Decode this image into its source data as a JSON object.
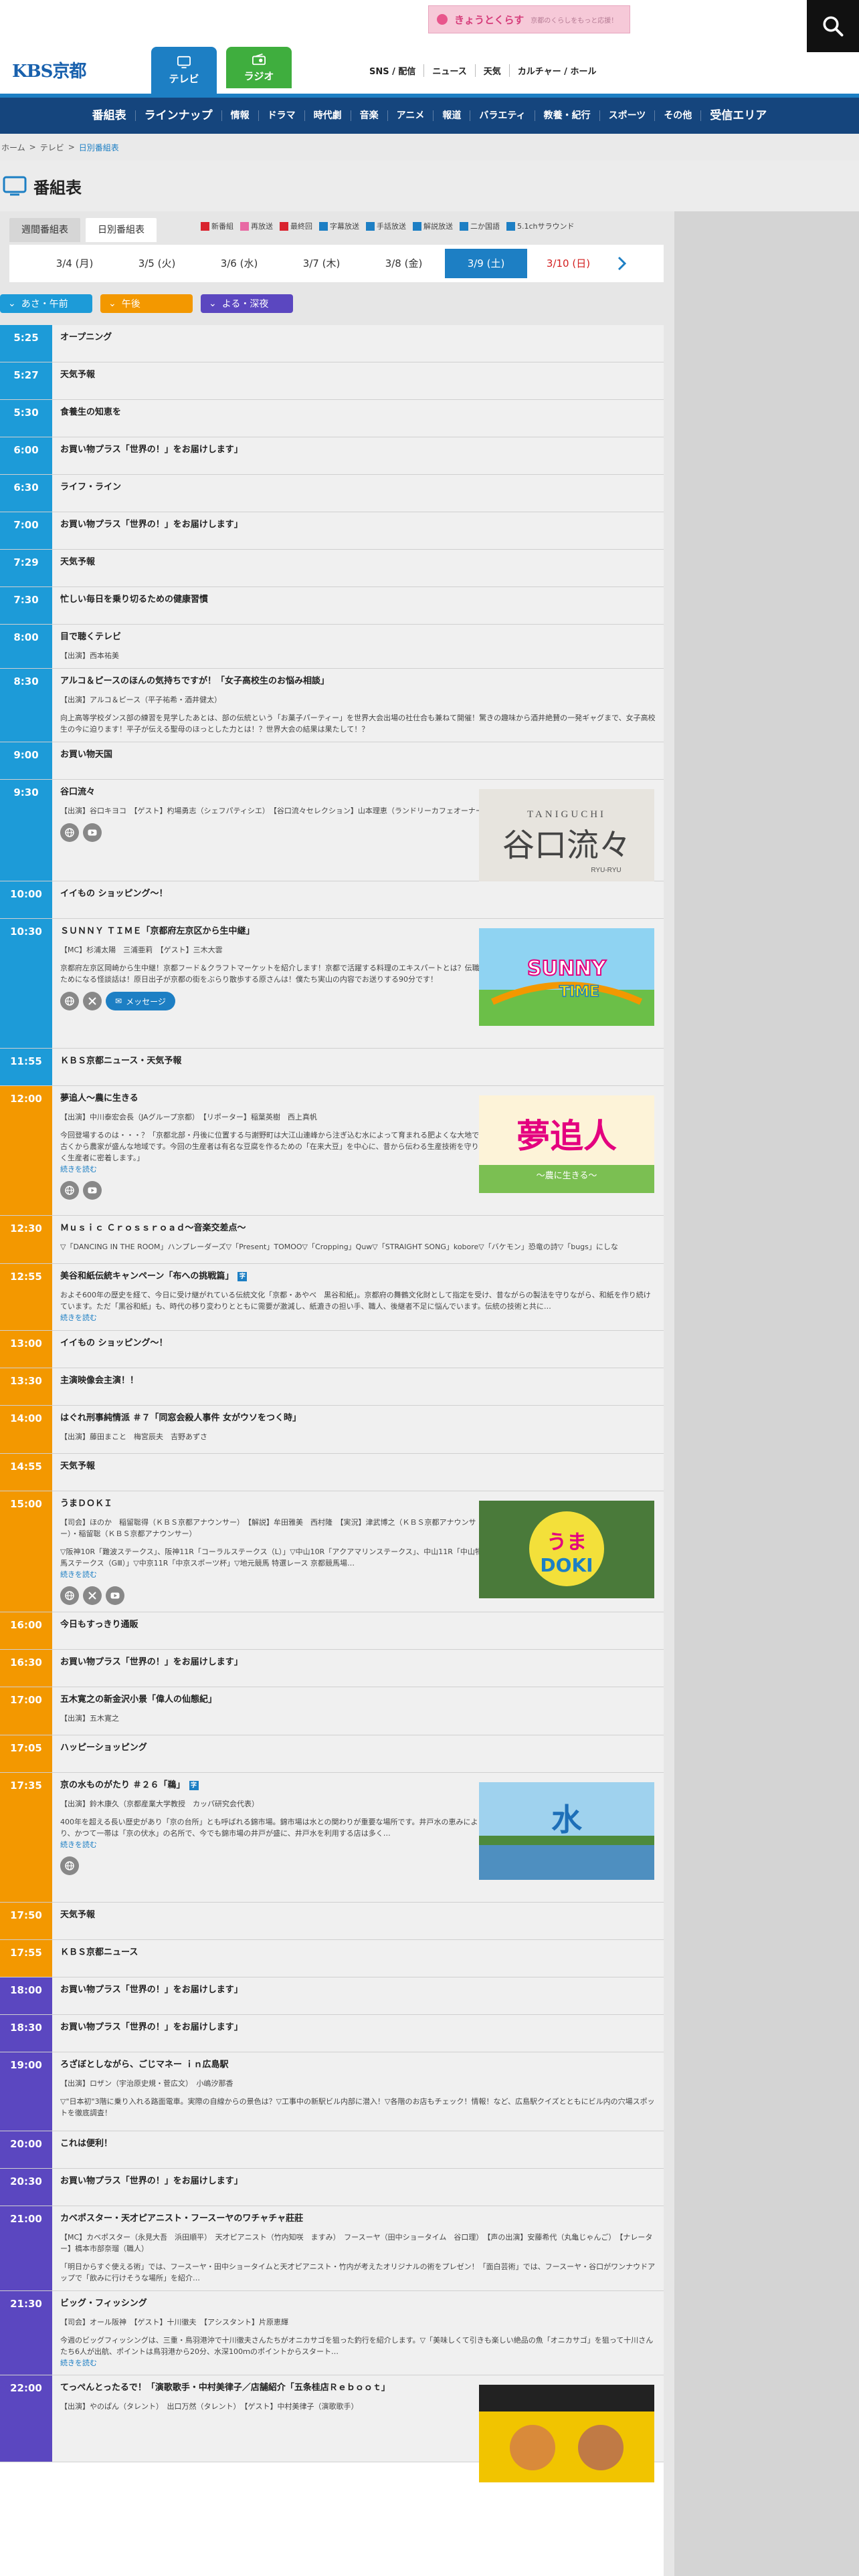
{
  "header": {
    "logo_text": "KBS京都",
    "promo_title": "きょうとくらす",
    "promo_sub": "京都のくらしをもっと応援！",
    "tab_tv": "テレビ",
    "tab_radio": "ラジオ",
    "links": [
      "SNS / 配信",
      "ニュース",
      "天気",
      "カルチャー / ホール"
    ]
  },
  "genre_nav": [
    "番組表",
    "ラインナップ",
    "情報",
    "ドラマ",
    "時代劇",
    "音楽",
    "アニメ",
    "報道",
    "バラエティ",
    "教養・紀行",
    "スポーツ",
    "その他",
    "受信エリア"
  ],
  "breadcrumb": [
    "ホーム",
    "テレビ",
    "日別番組表"
  ],
  "page_title": "番組表",
  "view_tabs": [
    "週間番組表",
    "日別番組表"
  ],
  "legend": [
    {
      "label": "新番組",
      "color": "#d9232e"
    },
    {
      "label": "再放送",
      "color": "#e86aa4"
    },
    {
      "label": "最終回",
      "color": "#d9232e"
    },
    {
      "label": "字幕放送",
      "color": "#1d7fc4"
    },
    {
      "label": "手話放送",
      "color": "#1d7fc4"
    },
    {
      "label": "解説放送",
      "color": "#1d7fc4"
    },
    {
      "label": "二か国語",
      "color": "#1d7fc4"
    },
    {
      "label": "5.1chサラウンド",
      "color": "#1d7fc4"
    }
  ],
  "dates": [
    "3/4 (月)",
    "3/5 (火)",
    "3/6 (水)",
    "3/7 (木)",
    "3/8 (金)",
    "3/9 (土)",
    "3/10 (日)"
  ],
  "time_tabs": [
    "あさ・午前",
    "午後",
    "よる・深夜"
  ],
  "programs": [
    {
      "time": "5:25",
      "title": "オープニング",
      "band": "m"
    },
    {
      "time": "5:27",
      "title": "天気予報",
      "band": "m"
    },
    {
      "time": "5:30",
      "title": "食養生の知恵を",
      "band": "m"
    },
    {
      "time": "6:00",
      "title": "お買い物プラス「世界の！」をお届けします」",
      "band": "m"
    },
    {
      "time": "6:30",
      "title": "ライフ・ライン",
      "band": "m"
    },
    {
      "time": "7:00",
      "title": "お買い物プラス「世界の！」をお届けします」",
      "band": "m"
    },
    {
      "time": "7:29",
      "title": "天気予報",
      "band": "m"
    },
    {
      "time": "7:30",
      "title": "忙しい毎日を乗り切るための健康習慣",
      "band": "m"
    },
    {
      "time": "8:00",
      "title": "目で聴くテレビ",
      "band": "m",
      "detail": "【出演】西本祐美"
    },
    {
      "time": "8:30",
      "title": "アルコ＆ピースのほんの気持ちですが！「女子高校生のお悩み相談」",
      "band": "m",
      "detail": "【出演】アルコ＆ピース（平子祐希・酒井健太）",
      "desc": "向上高等学校ダンス部の練習を見学したあとは、部の伝統という「お菓子パーティー」を世界大会出場の社仕合も兼ねて開催！驚きの趣味から酒井絶賛の一発ギャグまで、女子高校生の今に迫ります！平子が伝える聖母のほっとした力とは！？世界大会の結果は果たして！？"
    },
    {
      "time": "9:00",
      "title": "お買い物天国",
      "band": "m"
    },
    {
      "time": "9:30",
      "title": "谷口流々",
      "band": "m",
      "img": "taniguchi",
      "detail": "【出演】谷口キヨコ　【ゲスト】杓場勇志（シェフパティシエ）　【谷口流々セレクション】山本理恵（ランドリーカフェオーナー）",
      "icons": [
        "web",
        "yt"
      ]
    },
    {
      "time": "10:00",
      "title": "イイもの ショッピング〜！",
      "band": "m"
    },
    {
      "time": "10:30",
      "title": "ＳＵＮＮＹ ＴＩＭＥ「京都府左京区から生中継」",
      "band": "m",
      "img": "sunny",
      "detail": "【MC】杉浦太陽　三浦亜莉　【ゲスト】三木大雲",
      "desc": "京都府左京区岡崎から生中継！京都フード＆クラフトマーケットを紹介します！京都で活躍する料理のエキスパートとは？伝職のためになる怪談話は！原日出子が京都の街をぶらり散歩する原さんは！僕たち実山の内容でお送りする90分です！",
      "icons": [
        "web",
        "x"
      ],
      "msg": "メッセージ"
    },
    {
      "time": "11:55",
      "title": "ＫＢＳ京都ニュース・天気予報",
      "band": "m"
    },
    {
      "time": "12:00",
      "title": "夢追人〜農に生きる",
      "band": "a",
      "img": "yume",
      "detail": "【出演】中川泰宏会長（JAグループ京都）　【リポーター】稲葉英樹　西上真帆",
      "desc": "今回登場するのは・・・？「京都北部・丹後に位置する与謝野町は大江山連峰から注ぎ込む水によって育まれる肥よくな大地で、古くから農家が盛んな地域です。今回の生産者は有名な豆腐を作るための「在来大豆」を中心に、昔から伝わる生産技術を守り抜く生産者に密着します。」",
      "more": "続きを読む",
      "icons": [
        "web",
        "yt"
      ]
    },
    {
      "time": "12:30",
      "title": "Ｍｕｓｉｃ Ｃｒｏｓｓｒｏａｄ〜音楽交差点〜",
      "band": "a",
      "desc": "▽「DANCING IN THE ROOM」ハンプレーダーズ▽「Present」TOMOO▽「Cropping」Quw▽「STRAIGHT SONG」kobore▽「バケモン」恐竜の詩▽「bugs」にしな"
    },
    {
      "time": "12:55",
      "title": "美谷和紙伝統キャンペーン「布への挑戦篇」",
      "band": "a",
      "badge": "字",
      "desc": "およそ600年の歴史を経て、今日に受け継がれている伝統文化「京都・あやべ　黒谷和紙」。京都府の舞鶴文化財として指定を受け、昔ながらの製法を守りながら、和紙を作り続けています。ただ「黒谷和紙」も、時代の移り変わりとともに需要が激減し、紙漉きの担い手、職人、後継者不足に悩んでいます。伝統の技術と共に…",
      "more": "続きを読む"
    },
    {
      "time": "13:00",
      "title": "イイもの ショッピング〜！",
      "band": "a"
    },
    {
      "time": "13:30",
      "title": "主演映像会主演！！",
      "band": "a"
    },
    {
      "time": "14:00",
      "title": "はぐれ刑事純情派 ＃７「同窓会殺人事件 女がウソをつく時」",
      "band": "a",
      "detail": "【出演】藤田まこと　梅宮辰夫　吉野あずさ"
    },
    {
      "time": "14:55",
      "title": "天気予報",
      "band": "a"
    },
    {
      "time": "15:00",
      "title": "うまＤＯＫＩ",
      "band": "a",
      "img": "umadoki",
      "detail": "【司会】ほのか　稲留聡得（ＫＢＳ京都アナウンサー）　【解説】牟田雅美　西村隆　【実況】津武博之（ＫＢＳ京都アナウンサー）・稲留聡（ＫＢＳ京都アナウンサー）",
      "desc": "▽阪神10R「難波ステークス」、阪神11R「コーラルステークス（L）」▽中山10R「アクアマリンステークス」、中山11R「中山牝馬ステークス（GⅢ）」▽中京11R「中京スポーツ杯」▽地元競馬 特選レース 京都競馬場…",
      "more": "続きを読む",
      "icons": [
        "web",
        "x",
        "yt"
      ]
    },
    {
      "time": "16:00",
      "title": "今日もすっきり通販",
      "band": "a"
    },
    {
      "time": "16:30",
      "title": "お買い物プラス「世界の！」をお届けします」",
      "band": "a"
    },
    {
      "time": "17:00",
      "title": "五木寛之の新金沢小景「偉人の仙態紀」",
      "band": "a",
      "detail": "【出演】五木寛之"
    },
    {
      "time": "17:05",
      "title": "ハッピーショッピング",
      "band": "a"
    },
    {
      "time": "17:35",
      "title": "京の水ものがたり ＃２６「鵜」",
      "band": "a",
      "badge": "字",
      "img": "mizu",
      "detail": "【出演】鈴木康久（京都産業大学教授　カッパ研究会代表）",
      "desc": "400年を超える長い歴史があり「京の台所」とも呼ばれる錦市場。錦市場は水との関わりが重要な場所です。井戸水の恵みにより、かつて一帯は「京の伏水」の名所で、今でも錦市場の井戸が盛に、井戸水を利用する店は多く…",
      "more": "続きを読む",
      "icons": [
        "web"
      ]
    },
    {
      "time": "17:50",
      "title": "天気予報",
      "band": "a"
    },
    {
      "time": "17:55",
      "title": "ＫＢＳ京都ニュース",
      "band": "a"
    },
    {
      "time": "18:00",
      "title": "お買い物プラス「世界の！」をお届けします」",
      "band": "n"
    },
    {
      "time": "18:30",
      "title": "お買い物プラス「世界の！」をお届けします」",
      "band": "n"
    },
    {
      "time": "19:00",
      "title": "ろざぼとしながら、ごじマネー ｉｎ広島駅",
      "band": "n",
      "detail": "【出演】ロザン（宇治原史規・菅広文）　小嶋汐那香",
      "desc": "▽\"日本初\"3階に乗り入れる路面電車。実際の自線からの景色は？▽工事中の新駅ビル内部に潜入！▽各階のお店もチェック！情報！など、広島駅クイズとともにビル内の穴場スポットを徹底調査！"
    },
    {
      "time": "20:00",
      "title": "これは便利！",
      "band": "n"
    },
    {
      "time": "20:30",
      "title": "お買い物プラス「世界の！」をお届けします」",
      "band": "n"
    },
    {
      "time": "21:00",
      "title": "カベポスター・天才ピアニスト・フースーヤのワチャチャ莊莊",
      "band": "n",
      "detail": "【MC】カベポスター（永見大吾　浜田順平）　天才ピアニスト（竹内知咲　ますみ）　フースーヤ（田中ショータイム　谷口理）　【声の出演】安藤希代（丸亀じゃんご）　【ナレーター】橋本市部奈瑠（職人）",
      "desc": "「明日からすぐ使える術」では、フースーヤ・田中ショータイムと天才ピアニスト・竹内が考えたオリジナルの術をプレゼン！「面白芸術」では、フースーヤ・谷口がワンナウドアップで「飲みに行けそうな場所」を紹介…"
    },
    {
      "time": "21:30",
      "title": "ビッグ・フィッシング",
      "band": "n",
      "detail": "【司会】オール阪神　【ゲスト】十川徹夫　【アシスタント】片原恵輝",
      "desc": "今週のビッグフィッシングは、三重・鳥羽港沖で十川徹夫さんたちがオニカサゴを狙った釣行を紹介します。▽「美味しくて引きも楽しい絶品の魚「オニカサゴ」を狙って十川さんたち6人が出航、ポイントは鳥羽港から20分、水深100ｍのポイントからスタート…",
      "more": "続きを読む"
    },
    {
      "time": "22:00",
      "title": "てっぺんとったるで！「演歌歌手・中村美律子／店舗紹介「五条桂店Ｒｅｂｏｏｔ」",
      "band": "n",
      "img": "teppen",
      "detail": "【出演】やのぱん（タレント）　出口万然（タレント）　【ゲスト】中村美律子（演歌歌手）"
    }
  ]
}
